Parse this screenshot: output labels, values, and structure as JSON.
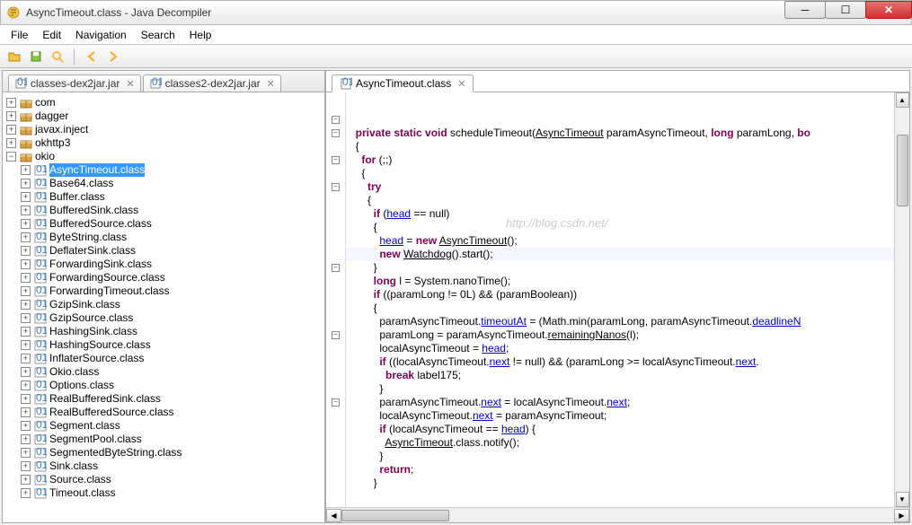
{
  "titlebar": {
    "title": "AsyncTimeout.class - Java Decompiler"
  },
  "menubar": {
    "items": [
      "File",
      "Edit",
      "Navigation",
      "Search",
      "Help"
    ]
  },
  "sidebar_tabs": [
    {
      "label": "classes-dex2jar.jar"
    },
    {
      "label": "classes2-dex2jar.jar"
    }
  ],
  "tree": {
    "packages": [
      {
        "name": "com",
        "expandable": true
      },
      {
        "name": "dagger",
        "expandable": true
      },
      {
        "name": "javax.inject",
        "expandable": true
      },
      {
        "name": "okhttp3",
        "expandable": true
      },
      {
        "name": "okio",
        "expandable": true,
        "expanded": true,
        "children": [
          {
            "name": "AsyncTimeout.class",
            "selected": true
          },
          {
            "name": "Base64.class"
          },
          {
            "name": "Buffer.class"
          },
          {
            "name": "BufferedSink.class"
          },
          {
            "name": "BufferedSource.class"
          },
          {
            "name": "ByteString.class"
          },
          {
            "name": "DeflaterSink.class"
          },
          {
            "name": "ForwardingSink.class"
          },
          {
            "name": "ForwardingSource.class"
          },
          {
            "name": "ForwardingTimeout.class"
          },
          {
            "name": "GzipSink.class"
          },
          {
            "name": "GzipSource.class"
          },
          {
            "name": "HashingSink.class"
          },
          {
            "name": "HashingSource.class"
          },
          {
            "name": "InflaterSource.class"
          },
          {
            "name": "Okio.class"
          },
          {
            "name": "Options.class"
          },
          {
            "name": "RealBufferedSink.class"
          },
          {
            "name": "RealBufferedSource.class"
          },
          {
            "name": "Segment.class"
          },
          {
            "name": "SegmentPool.class"
          },
          {
            "name": "SegmentedByteString.class"
          },
          {
            "name": "Sink.class"
          },
          {
            "name": "Source.class"
          },
          {
            "name": "Timeout.class"
          }
        ]
      }
    ]
  },
  "editor_tab": {
    "label": "AsyncTimeout.class"
  },
  "code": {
    "l1_a": "private static void",
    "l1_b": " scheduleTimeout(",
    "l1_c": "AsyncTimeout",
    "l1_d": " paramAsyncTimeout, ",
    "l1_e": "long",
    "l1_f": " paramLong, ",
    "l1_g": "bo",
    "l2": "{",
    "l3_a": "for",
    "l3_b": " (;;)",
    "l4": "{",
    "l5_a": "try",
    "l6": "{",
    "l7_a": "if",
    "l7_b": " (",
    "l7_c": "head",
    "l7_d": " == null)",
    "l8": "{",
    "l9_a": "head",
    "l9_b": " = ",
    "l9_c": "new",
    "l9_d": " ",
    "l9_e": "AsyncTimeout",
    "l9_f": "();",
    "l10_a": "new",
    "l10_b": " ",
    "l10_c": "Watchdog",
    "l10_d": "().start();",
    "l11": "}",
    "l12_a": "long",
    "l12_b": " l = System.nanoTime();",
    "l13_a": "if",
    "l13_b": " ((paramLong != 0L) && (paramBoolean))",
    "l14": "{",
    "l15_a": "paramAsyncTimeout.",
    "l15_b": "timeoutAt",
    "l15_c": " = (Math.min(paramLong, paramAsyncTimeout.",
    "l15_d": "deadlineN",
    "l16_a": "paramLong = paramAsyncTimeout.",
    "l16_b": "remainingNanos",
    "l16_c": "(l);",
    "l17_a": "localAsyncTimeout = ",
    "l17_b": "head",
    "l17_c": ";",
    "l18_a": "if",
    "l18_b": " ((localAsyncTimeout.",
    "l18_c": "next",
    "l18_d": " != null) && (paramLong >= localAsyncTimeout.",
    "l18_e": "next",
    "l18_f": ".",
    "l19_a": "break",
    "l19_b": " label175;",
    "l20": "}",
    "l21_a": "paramAsyncTimeout.",
    "l21_b": "next",
    "l21_c": " = localAsyncTimeout.",
    "l21_d": "next",
    "l21_e": ";",
    "l22_a": "localAsyncTimeout.",
    "l22_b": "next",
    "l22_c": " = paramAsyncTimeout;",
    "l23_a": "if",
    "l23_b": " (localAsyncTimeout == ",
    "l23_c": "head",
    "l23_d": ") {",
    "l24_a": "AsyncTimeout",
    "l24_b": ".class.notify();",
    "l25": "}",
    "l26_a": "return",
    "l26_b": ";",
    "l27": "}"
  },
  "watermark": "http://blog.csdn.net/"
}
